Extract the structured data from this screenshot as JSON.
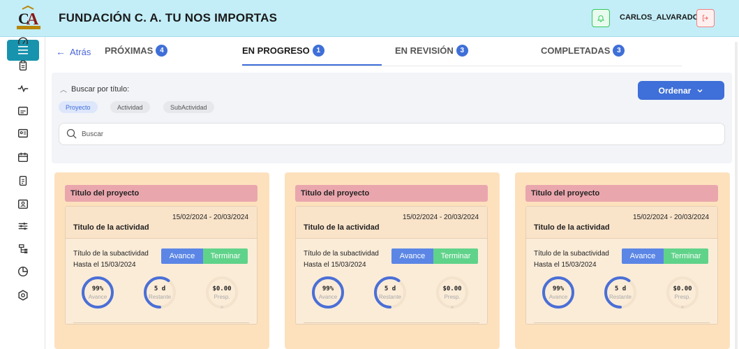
{
  "header": {
    "org_title": "FUNDACIÓN C. A. TU NOS IMPORTAS",
    "user_name": "CARLOS_ALVARADO"
  },
  "sidebar": {
    "icons": [
      "gauge-icon",
      "clipboard-icon",
      "pulse-icon",
      "folder-icon",
      "id-card-icon",
      "calendar-icon",
      "document-icon",
      "contact-card-icon",
      "sliders-icon",
      "hierarchy-icon",
      "pie-chart-icon",
      "settings-icon"
    ]
  },
  "nav": {
    "back_label": "Atrás",
    "tabs": [
      {
        "label": "PRÓXIMAS",
        "count": "4"
      },
      {
        "label": "EN PROGRESO",
        "count": "1"
      },
      {
        "label": "EN REVISIÓN",
        "count": "3"
      },
      {
        "label": "COMPLETADAS",
        "count": "3"
      }
    ]
  },
  "search": {
    "toggle_label": "Buscar por título:",
    "chips": [
      "Proyecto",
      "Actividad",
      "SubActividad"
    ],
    "placeholder": "Buscar",
    "sort_label": "Ordenar"
  },
  "cards": [
    {
      "project_title": "Titulo del proyecto",
      "activity_dates": "15/02/2024 - 20/03/2024",
      "activity_title": "Titulo de la actividad",
      "subactivity_title": "Título de la subactividad",
      "subactivity_until": "Hasta el 15/03/2024",
      "advance_label": "Avance",
      "finish_label": "Terminar",
      "gauges": [
        {
          "value": "99%",
          "label": "Avance",
          "fill": 0.99
        },
        {
          "value": "5 d",
          "label": "Restante",
          "fill": 0.6
        },
        {
          "value": "$0.00",
          "label": "Presp.",
          "fill": 0
        }
      ]
    },
    {
      "project_title": "Titulo del proyecto",
      "activity_dates": "15/02/2024 - 20/03/2024",
      "activity_title": "Titulo de la actividad",
      "subactivity_title": "Título de la subactividad",
      "subactivity_until": "Hasta el 15/03/2024",
      "advance_label": "Avance",
      "finish_label": "Terminar",
      "gauges": [
        {
          "value": "99%",
          "label": "Avance",
          "fill": 0.99
        },
        {
          "value": "5 d",
          "label": "Restante",
          "fill": 0.6
        },
        {
          "value": "$0.00",
          "label": "Presp.",
          "fill": 0
        }
      ]
    },
    {
      "project_title": "Titulo del proyecto",
      "activity_dates": "15/02/2024 - 20/03/2024",
      "activity_title": "Titulo de la actividad",
      "subactivity_title": "Título de la subactividad",
      "subactivity_until": "Hasta el 15/03/2024",
      "advance_label": "Avance",
      "finish_label": "Terminar",
      "gauges": [
        {
          "value": "99%",
          "label": "Avance",
          "fill": 0.99
        },
        {
          "value": "5 d",
          "label": "Restante",
          "fill": 0.6
        },
        {
          "value": "$0.00",
          "label": "Presp.",
          "fill": 0
        }
      ]
    }
  ],
  "colors": {
    "header_bg": "#c3eef8",
    "accent": "#3f6fd8",
    "success": "#60d38a",
    "card_bg": "#fde1bd",
    "project_bar": "#eaa6ad"
  }
}
